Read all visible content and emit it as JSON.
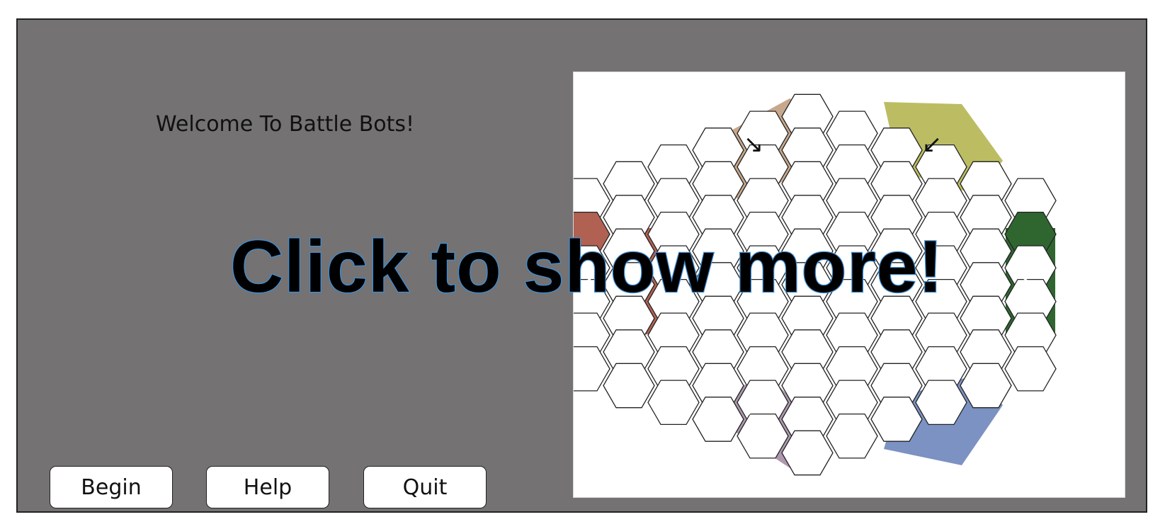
{
  "window": {
    "welcome_text": "Welcome To Battle Bots!",
    "overlay_text": "Click to show more!"
  },
  "buttons": {
    "begin": "Begin",
    "help": "Help",
    "quit": "Quit"
  },
  "board": {
    "corner_colors": {
      "top_left": "#c8a88c",
      "top_right": "#bcbd62",
      "left": "#b06152",
      "right": "#2f6630",
      "bottom_left": "#ad98ad",
      "bottom_right": "#7b92c2"
    },
    "start_arrows": [
      {
        "position": "top_left",
        "glyph": "↘"
      },
      {
        "position": "top_right",
        "glyph": "↙"
      },
      {
        "position": "left",
        "glyph": "→"
      },
      {
        "position": "right",
        "glyph": "←"
      },
      {
        "position": "bottom_left",
        "glyph": "↗"
      },
      {
        "position": "bottom_right",
        "glyph": "↖"
      }
    ]
  }
}
